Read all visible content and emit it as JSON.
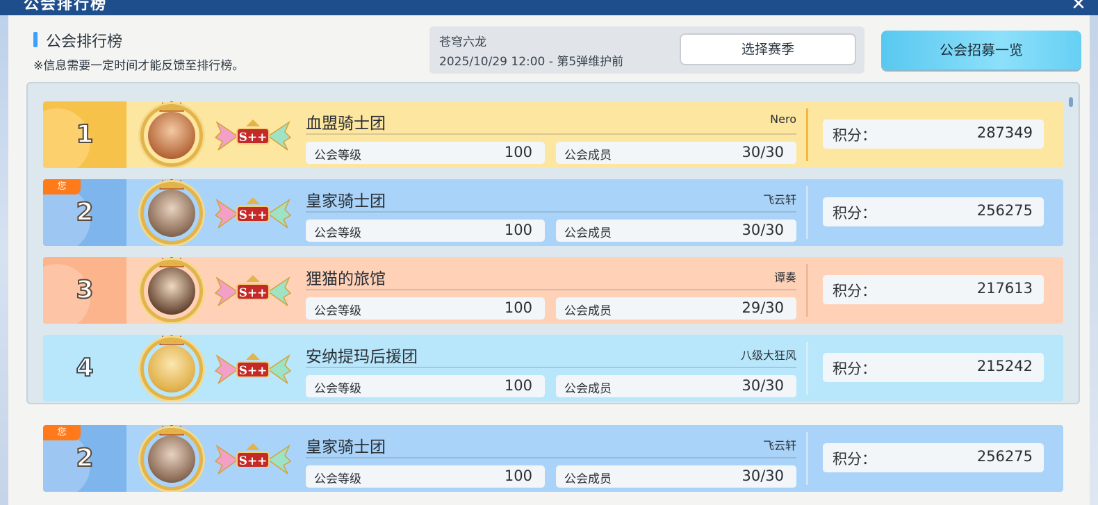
{
  "window": {
    "title": "公会排行榜"
  },
  "header": {
    "title": "公会排行榜",
    "note": "※信息需要一定时间才能反馈至排行榜。"
  },
  "season": {
    "name": "苍穹六龙",
    "date": "2025/10/29 12:00 - 第5弹维护前",
    "select_label": "选择赛季"
  },
  "recruit_label": "公会招募一览",
  "stat_labels": {
    "level": "公会等级",
    "members": "公会成员",
    "score": "积分："
  },
  "you_label": "您",
  "colors": {
    "gold": "#fde6a0",
    "blue": "#a9d3f8",
    "orange": "#ffd2b8",
    "cyan": "#b8e6fb",
    "accent": "#3aa0ff",
    "you_badge": "#ff7a1a"
  },
  "rows": [
    {
      "rank": "1",
      "guild": "血盟骑士团",
      "leader": "Nero",
      "level": "100",
      "members": "30/30",
      "score": "287349",
      "badge": "S++",
      "is_you": false
    },
    {
      "rank": "2",
      "guild": "皇家骑士团",
      "leader": "飞云轩",
      "level": "100",
      "members": "30/30",
      "score": "256275",
      "badge": "S++",
      "is_you": true
    },
    {
      "rank": "3",
      "guild": "狸猫的旅馆",
      "leader": "谭奏",
      "level": "100",
      "members": "29/30",
      "score": "217613",
      "badge": "S++",
      "is_you": false
    },
    {
      "rank": "4",
      "guild": "安纳提玛后援团",
      "leader": "八级大狂风",
      "level": "100",
      "members": "30/30",
      "score": "215242",
      "badge": "S++",
      "is_you": false
    }
  ],
  "own": {
    "rank": "2",
    "guild": "皇家骑士团",
    "leader": "飞云轩",
    "level": "100",
    "members": "30/30",
    "score": "256275",
    "badge": "S++"
  }
}
